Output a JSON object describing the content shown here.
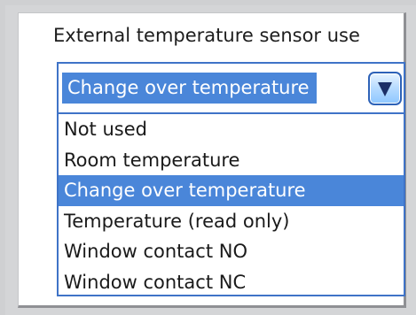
{
  "control": {
    "title": "External temperature sensor use",
    "selected_value": "Change over temperature",
    "dropdown_icon": "triangle-down-icon"
  },
  "options": [
    {
      "label": "Not used",
      "selected": false
    },
    {
      "label": "Room temperature",
      "selected": false
    },
    {
      "label": "Change over temperature",
      "selected": true
    },
    {
      "label": "Temperature (read only)",
      "selected": false
    },
    {
      "label": "Window contact NO",
      "selected": false
    },
    {
      "label": "Window contact NC",
      "selected": false
    }
  ],
  "colors": {
    "accent": "#4a86d9",
    "border": "#3f73c7",
    "button_dark": "#1c2f66"
  }
}
